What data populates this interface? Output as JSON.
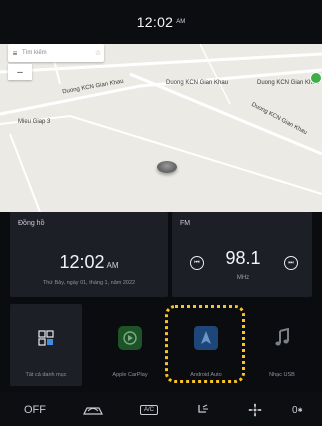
{
  "status": {
    "time": "12:02",
    "ampm": "AM"
  },
  "map": {
    "search_placeholder": "Tìm kiếm",
    "zoom_out_label": "–",
    "road_labels": [
      "Duong KCN Gian Khau",
      "Duong KCN Gian Khau",
      "Duong KCN Gian Khau",
      "Duong KCN Gian Khau",
      "Mieu Giap 3"
    ]
  },
  "clock_card": {
    "title": "Đồng hồ",
    "time": "12:02",
    "ampm": "AM",
    "date": "Thứ Bảy, ngày 01, tháng 1, năm 2022"
  },
  "fm_card": {
    "title": "FM",
    "frequency": "98.1",
    "unit": "MHz"
  },
  "apps": [
    {
      "label": "Tất cả danh mục",
      "icon": "grid-icon"
    },
    {
      "label": "Apple CarPlay",
      "icon": "carplay-icon"
    },
    {
      "label": "Android Auto",
      "icon": "android-auto-icon"
    },
    {
      "label": "Nhạc USB",
      "icon": "music-note-icon"
    }
  ],
  "climate": {
    "power_label": "OFF",
    "ac_label": "A/C",
    "temp_label": "0"
  },
  "colors": {
    "background": "#0a0c10",
    "card": "#1c1f25",
    "highlight": "#f7c325",
    "carplay_green": "#2c8e3a",
    "android_blue": "#245a9c"
  }
}
